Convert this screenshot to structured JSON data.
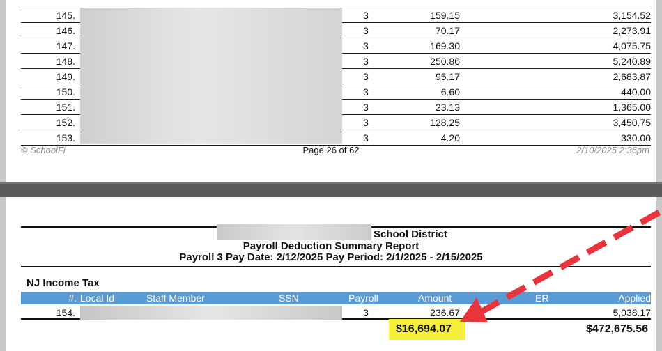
{
  "page1": {
    "rows": [
      {
        "num": "145.",
        "payroll": "3",
        "amount": "159.15",
        "applied": "3,154.52"
      },
      {
        "num": "146.",
        "payroll": "3",
        "amount": "70.17",
        "applied": "2,273.91"
      },
      {
        "num": "147.",
        "payroll": "3",
        "amount": "169.30",
        "applied": "4,075.75"
      },
      {
        "num": "148.",
        "payroll": "3",
        "amount": "250.86",
        "applied": "5,240.89"
      },
      {
        "num": "149.",
        "payroll": "3",
        "amount": "95.17",
        "applied": "2,683.87"
      },
      {
        "num": "150.",
        "payroll": "3",
        "amount": "6.60",
        "applied": "440.00"
      },
      {
        "num": "151.",
        "payroll": "3",
        "amount": "23.13",
        "applied": "1,365.00"
      },
      {
        "num": "152.",
        "payroll": "3",
        "amount": "128.25",
        "applied": "3,450.75"
      },
      {
        "num": "153.",
        "payroll": "3",
        "amount": "4.20",
        "applied": "330.00"
      }
    ],
    "footer": {
      "copyright": "© SchoolFi",
      "page": "Page 26 of 62",
      "timestamp": "2/10/2025 2:36pm"
    }
  },
  "page2": {
    "district_suffix": "School District",
    "report_title": "Payroll Deduction Summary Report",
    "report_subtitle": "Payroll 3 Pay Date: 2/12/2025  Pay Period: 2/1/2025 - 2/15/2025",
    "section": "NJ Income Tax",
    "headers": {
      "num": "#.",
      "local_id": "Local Id",
      "staff": "Staff Member",
      "ssn": "SSN",
      "payroll": "Payroll",
      "amount": "Amount",
      "er": "ER",
      "applied": "Applied"
    },
    "row": {
      "num": "154.",
      "payroll": "3",
      "amount": "236.67",
      "applied": "5,038.17"
    },
    "totals": {
      "amount": "$16,694.07",
      "applied": "$472,675.56"
    }
  },
  "colors": {
    "header_bg": "#5b9bd5",
    "highlight": "#f5ee3a",
    "arrow": "#e8343a"
  }
}
